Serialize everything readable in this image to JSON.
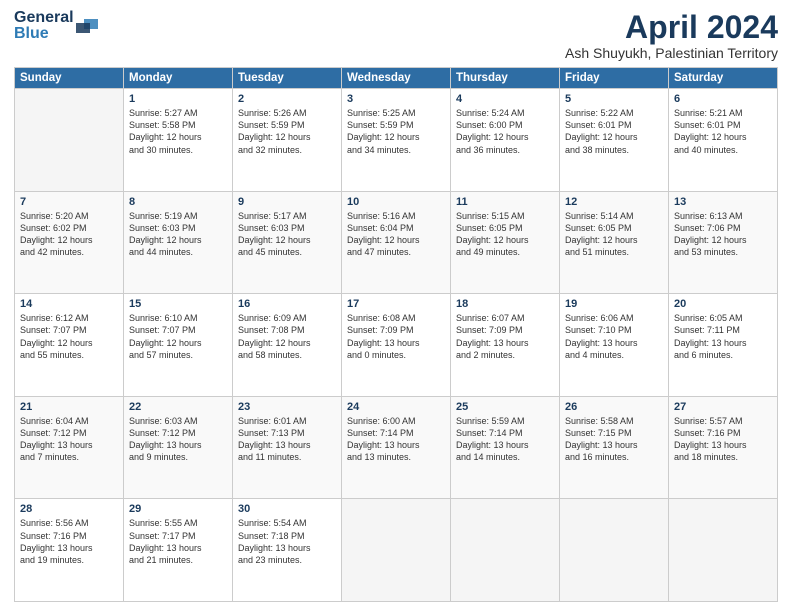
{
  "logo": {
    "line1": "General",
    "line2": "Blue"
  },
  "title": "April 2024",
  "subtitle": "Ash Shuyukh, Palestinian Territory",
  "headers": [
    "Sunday",
    "Monday",
    "Tuesday",
    "Wednesday",
    "Thursday",
    "Friday",
    "Saturday"
  ],
  "weeks": [
    [
      {
        "day": "",
        "info": ""
      },
      {
        "day": "1",
        "info": "Sunrise: 5:27 AM\nSunset: 5:58 PM\nDaylight: 12 hours\nand 30 minutes."
      },
      {
        "day": "2",
        "info": "Sunrise: 5:26 AM\nSunset: 5:59 PM\nDaylight: 12 hours\nand 32 minutes."
      },
      {
        "day": "3",
        "info": "Sunrise: 5:25 AM\nSunset: 5:59 PM\nDaylight: 12 hours\nand 34 minutes."
      },
      {
        "day": "4",
        "info": "Sunrise: 5:24 AM\nSunset: 6:00 PM\nDaylight: 12 hours\nand 36 minutes."
      },
      {
        "day": "5",
        "info": "Sunrise: 5:22 AM\nSunset: 6:01 PM\nDaylight: 12 hours\nand 38 minutes."
      },
      {
        "day": "6",
        "info": "Sunrise: 5:21 AM\nSunset: 6:01 PM\nDaylight: 12 hours\nand 40 minutes."
      }
    ],
    [
      {
        "day": "7",
        "info": "Sunrise: 5:20 AM\nSunset: 6:02 PM\nDaylight: 12 hours\nand 42 minutes."
      },
      {
        "day": "8",
        "info": "Sunrise: 5:19 AM\nSunset: 6:03 PM\nDaylight: 12 hours\nand 44 minutes."
      },
      {
        "day": "9",
        "info": "Sunrise: 5:17 AM\nSunset: 6:03 PM\nDaylight: 12 hours\nand 45 minutes."
      },
      {
        "day": "10",
        "info": "Sunrise: 5:16 AM\nSunset: 6:04 PM\nDaylight: 12 hours\nand 47 minutes."
      },
      {
        "day": "11",
        "info": "Sunrise: 5:15 AM\nSunset: 6:05 PM\nDaylight: 12 hours\nand 49 minutes."
      },
      {
        "day": "12",
        "info": "Sunrise: 5:14 AM\nSunset: 6:05 PM\nDaylight: 12 hours\nand 51 minutes."
      },
      {
        "day": "13",
        "info": "Sunrise: 6:13 AM\nSunset: 7:06 PM\nDaylight: 12 hours\nand 53 minutes."
      }
    ],
    [
      {
        "day": "14",
        "info": "Sunrise: 6:12 AM\nSunset: 7:07 PM\nDaylight: 12 hours\nand 55 minutes."
      },
      {
        "day": "15",
        "info": "Sunrise: 6:10 AM\nSunset: 7:07 PM\nDaylight: 12 hours\nand 57 minutes."
      },
      {
        "day": "16",
        "info": "Sunrise: 6:09 AM\nSunset: 7:08 PM\nDaylight: 12 hours\nand 58 minutes."
      },
      {
        "day": "17",
        "info": "Sunrise: 6:08 AM\nSunset: 7:09 PM\nDaylight: 13 hours\nand 0 minutes."
      },
      {
        "day": "18",
        "info": "Sunrise: 6:07 AM\nSunset: 7:09 PM\nDaylight: 13 hours\nand 2 minutes."
      },
      {
        "day": "19",
        "info": "Sunrise: 6:06 AM\nSunset: 7:10 PM\nDaylight: 13 hours\nand 4 minutes."
      },
      {
        "day": "20",
        "info": "Sunrise: 6:05 AM\nSunset: 7:11 PM\nDaylight: 13 hours\nand 6 minutes."
      }
    ],
    [
      {
        "day": "21",
        "info": "Sunrise: 6:04 AM\nSunset: 7:12 PM\nDaylight: 13 hours\nand 7 minutes."
      },
      {
        "day": "22",
        "info": "Sunrise: 6:03 AM\nSunset: 7:12 PM\nDaylight: 13 hours\nand 9 minutes."
      },
      {
        "day": "23",
        "info": "Sunrise: 6:01 AM\nSunset: 7:13 PM\nDaylight: 13 hours\nand 11 minutes."
      },
      {
        "day": "24",
        "info": "Sunrise: 6:00 AM\nSunset: 7:14 PM\nDaylight: 13 hours\nand 13 minutes."
      },
      {
        "day": "25",
        "info": "Sunrise: 5:59 AM\nSunset: 7:14 PM\nDaylight: 13 hours\nand 14 minutes."
      },
      {
        "day": "26",
        "info": "Sunrise: 5:58 AM\nSunset: 7:15 PM\nDaylight: 13 hours\nand 16 minutes."
      },
      {
        "day": "27",
        "info": "Sunrise: 5:57 AM\nSunset: 7:16 PM\nDaylight: 13 hours\nand 18 minutes."
      }
    ],
    [
      {
        "day": "28",
        "info": "Sunrise: 5:56 AM\nSunset: 7:16 PM\nDaylight: 13 hours\nand 19 minutes."
      },
      {
        "day": "29",
        "info": "Sunrise: 5:55 AM\nSunset: 7:17 PM\nDaylight: 13 hours\nand 21 minutes."
      },
      {
        "day": "30",
        "info": "Sunrise: 5:54 AM\nSunset: 7:18 PM\nDaylight: 13 hours\nand 23 minutes."
      },
      {
        "day": "",
        "info": ""
      },
      {
        "day": "",
        "info": ""
      },
      {
        "day": "",
        "info": ""
      },
      {
        "day": "",
        "info": ""
      }
    ]
  ]
}
